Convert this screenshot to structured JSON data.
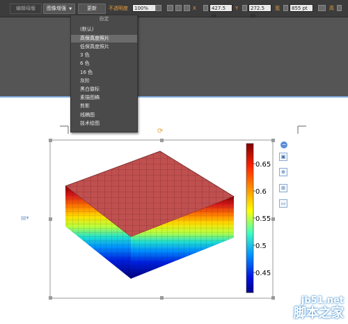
{
  "toolbar": {
    "edit_template": "编辑母版",
    "image_enhance": "图像增强",
    "image_dropdown_arrow": "▼",
    "change_button": "更新",
    "opacity_label": "不透明度",
    "opacity_value": "100%",
    "x_value": "427.5 pt",
    "y_value": "272.5 pt",
    "w_value": "855 pt",
    "x_label": "X",
    "y_label": "Y",
    "w_label": "宽",
    "h_label": "高"
  },
  "menu": {
    "items": [
      {
        "label": "自定"
      },
      {
        "label": "(默认)"
      },
      {
        "label": "高保真度照片"
      },
      {
        "label": "低保真度照片"
      },
      {
        "label": "3 色"
      },
      {
        "label": "6 色"
      },
      {
        "label": "16 色"
      },
      {
        "label": "灰阶"
      },
      {
        "label": "黑白徽标"
      },
      {
        "label": "素描图稿"
      },
      {
        "label": "剪影"
      },
      {
        "label": "线稿图"
      },
      {
        "label": "技术绘图"
      }
    ],
    "selected": "高保真度照片"
  },
  "colorbar": {
    "ticks": [
      "0.65",
      "0.6",
      "0.55",
      "0.5",
      "0.45"
    ]
  },
  "side_tools": [
    "minus-icon",
    "image-edit-icon",
    "zoom-icon",
    "crop-icon",
    "frame-icon"
  ],
  "watermark": {
    "site": "jb51.net",
    "name": "脚本之家"
  },
  "colors": {
    "toolbar_bg": "#3c3c3c",
    "workspace_bg": "#555555",
    "page_border": "#7ea8d8",
    "box_top": "#b04a4a",
    "orange_accent": "#e8a040"
  }
}
